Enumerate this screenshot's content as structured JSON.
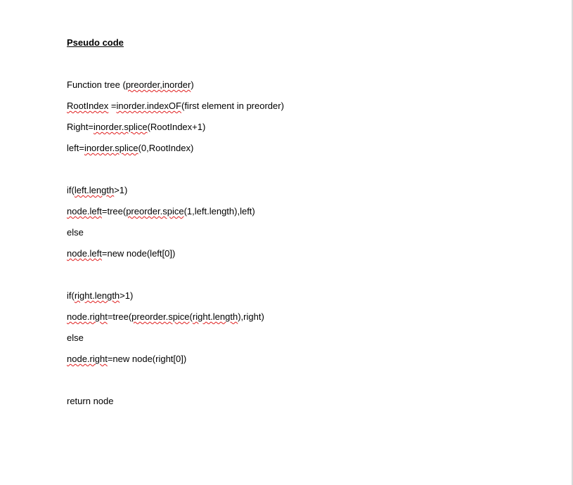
{
  "document": {
    "title": "Pseudo code",
    "lines": [
      [
        {
          "t": "Function tree ("
        },
        {
          "t": "preorder,inorder",
          "sq": true
        },
        {
          "t": ")"
        }
      ],
      [
        {
          "t": "RootIndex",
          "sq": true
        },
        {
          "t": " ="
        },
        {
          "t": "inorder.indexOF",
          "sq": true
        },
        {
          "t": "(first element in preorder)"
        }
      ],
      [
        {
          "t": "Right="
        },
        {
          "t": "inorder.splice",
          "sq": true
        },
        {
          "t": "(RootIndex+1)"
        }
      ],
      [
        {
          "t": "left="
        },
        {
          "t": "inorder.splice",
          "sq": true
        },
        {
          "t": "(0,RootIndex)"
        }
      ],
      [
        {
          "t": "if("
        },
        {
          "t": "left.length",
          "sq": true
        },
        {
          "t": ">1)"
        }
      ],
      [
        {
          "t": "node.left",
          "sq": true
        },
        {
          "t": "=tree("
        },
        {
          "t": "preorder.spice",
          "sq": true
        },
        {
          "t": "(1,left.length),left)"
        }
      ],
      [
        {
          "t": "else"
        }
      ],
      [
        {
          "t": "node.left",
          "sq": true
        },
        {
          "t": "=new node(left[0])"
        }
      ],
      [
        {
          "t": "if("
        },
        {
          "t": "right.length",
          "sq": true
        },
        {
          "t": ">1)"
        }
      ],
      [
        {
          "t": "node.right",
          "sq": true
        },
        {
          "t": "=tree("
        },
        {
          "t": "preorder.spice",
          "sq": true
        },
        {
          "t": "("
        },
        {
          "t": "right.length",
          "sq": true
        },
        {
          "t": "),right)"
        }
      ],
      [
        {
          "t": "else"
        }
      ],
      [
        {
          "t": "node.right",
          "sq": true
        },
        {
          "t": "=new node(right[0])"
        }
      ],
      [
        {
          "t": "return node"
        }
      ]
    ]
  },
  "colors": {
    "spellcheck_squiggle": "#e02020",
    "text": "#000000",
    "background": "#ffffff"
  }
}
